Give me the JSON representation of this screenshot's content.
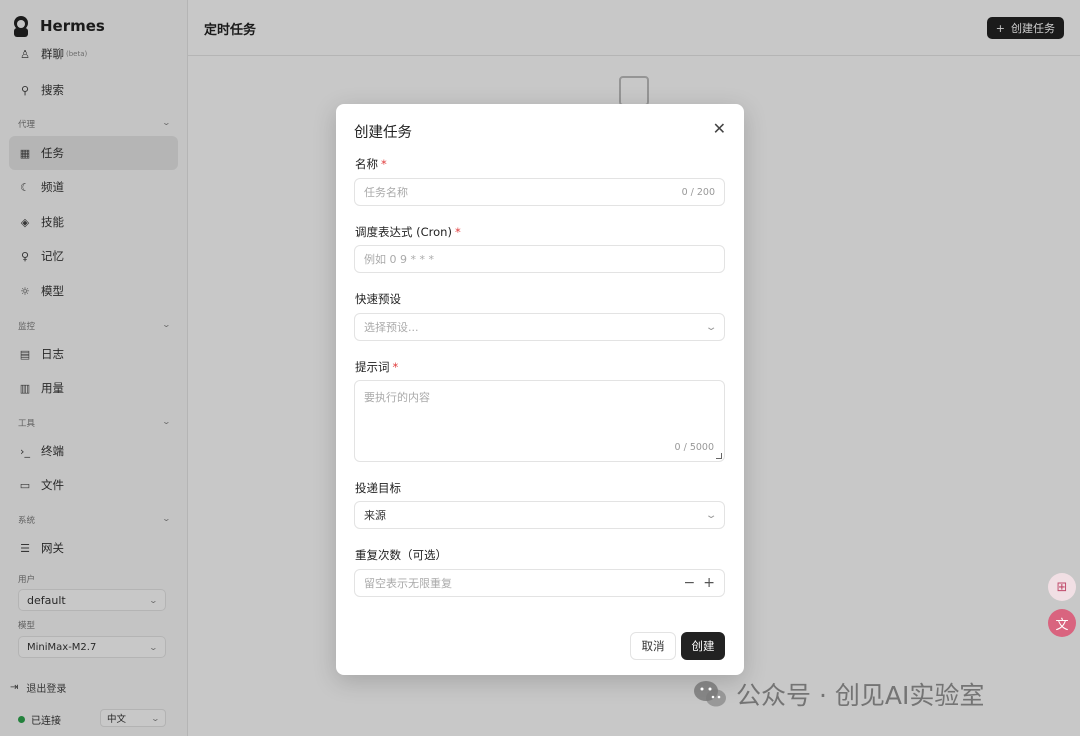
{
  "app": {
    "name": "Hermes"
  },
  "sidebar": {
    "items_top": [
      {
        "label": "群聊",
        "badge": "(beta)",
        "icon": "chat-icon"
      },
      {
        "label": "搜索",
        "icon": "search-icon"
      }
    ],
    "sections": [
      {
        "label": "代理",
        "items": [
          {
            "label": "任务",
            "icon": "calendar-icon",
            "active": true
          },
          {
            "label": "频道",
            "icon": "moon-icon"
          },
          {
            "label": "技能",
            "icon": "layers-icon"
          },
          {
            "label": "记忆",
            "icon": "lightbulb-icon"
          },
          {
            "label": "模型",
            "icon": "sun-icon"
          }
        ]
      },
      {
        "label": "监控",
        "items": [
          {
            "label": "日志",
            "icon": "document-icon"
          },
          {
            "label": "用量",
            "icon": "bar-chart-icon"
          }
        ]
      },
      {
        "label": "工具",
        "items": [
          {
            "label": "终端",
            "icon": "terminal-icon"
          },
          {
            "label": "文件",
            "icon": "folder-icon"
          }
        ]
      },
      {
        "label": "系统",
        "items": [
          {
            "label": "网关",
            "icon": "server-icon"
          }
        ]
      }
    ],
    "user_label": "用户",
    "user_value": "default",
    "model_label": "模型",
    "model_value": "MiniMax-M2.7",
    "logout": "退出登录",
    "status": "已连接",
    "language": "中文"
  },
  "header": {
    "title": "定时任务",
    "create_button": "创建任务"
  },
  "modal": {
    "title": "创建任务",
    "name_label": "名称",
    "name_placeholder": "任务名称",
    "name_counter": "0 / 200",
    "cron_label": "调度表达式 (Cron)",
    "cron_placeholder": "例如 0 9 * * *",
    "preset_label": "快速预设",
    "preset_placeholder": "选择预设...",
    "prompt_label": "提示词",
    "prompt_placeholder": "要执行的内容",
    "prompt_counter": "0 / 5000",
    "target_label": "投递目标",
    "target_value": "来源",
    "repeat_label": "重复次数（可选）",
    "repeat_placeholder": "留空表示无限重复",
    "required_mark": "*",
    "cancel": "取消",
    "create": "创建"
  },
  "watermark": {
    "text": "公众号 · 创见AI实验室"
  },
  "colors": {
    "accent": "#222222",
    "required": "#e03a3a",
    "connected": "#2ca24b"
  }
}
